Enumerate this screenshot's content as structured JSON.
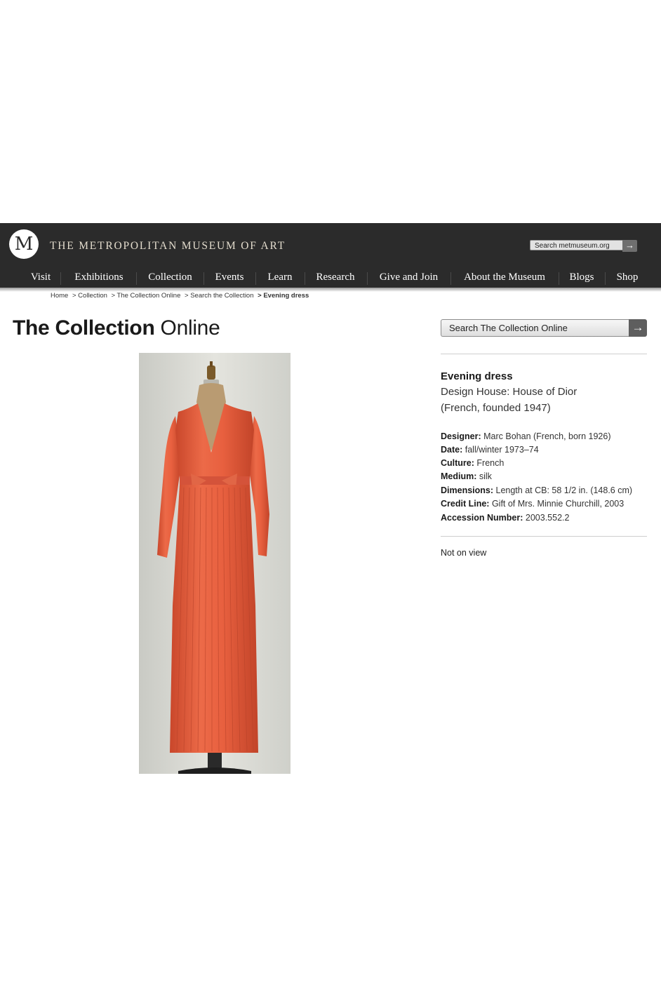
{
  "header": {
    "logo_letters": "M",
    "museum_name": "THE METROPOLITAN MUSEUM OF ART",
    "search_placeholder": "Search metmuseum.org",
    "search_button_icon": "arrow-right-icon",
    "background_color": "#2b2b2b"
  },
  "nav": {
    "items": [
      "Visit",
      "Exhibitions",
      "Collection",
      "Events",
      "Learn",
      "Research",
      "Give and Join",
      "About the Museum",
      "Blogs",
      "Shop"
    ],
    "active": "Collection"
  },
  "breadcrumb": {
    "items": [
      "Home",
      "> Collection",
      "> The Collection Online",
      "> Search the Collection"
    ],
    "current": "> Evening dress"
  },
  "page": {
    "title_bold": "The Collection",
    "title_light": "Online",
    "search_label": "Search The Collection Online",
    "search_button_icon": "arrow-right-icon"
  },
  "object": {
    "title": "Evening dress",
    "design_house": "Design House: House of Dior",
    "design_house_nationality": "(French, founded 1947)",
    "fields": [
      {
        "label": "Designer:",
        "value": "Marc Bohan (French, born 1926)"
      },
      {
        "label": "Date:",
        "value": "fall/winter 1973–74"
      },
      {
        "label": "Culture:",
        "value": "French"
      },
      {
        "label": "Medium:",
        "value": "silk"
      },
      {
        "label": "Dimensions:",
        "value": "Length at CB: 58 1/2 in. (148.6 cm)"
      },
      {
        "label": "Credit Line:",
        "value": "Gift of Mrs. Minnie Churchill, 2003"
      },
      {
        "label": "Accession Number:",
        "value": "2003.552.2"
      }
    ],
    "on_view_status": "Not on view",
    "image_subject": "orange pleated silk evening dress on dress form",
    "dress_color": "#e8603f"
  }
}
